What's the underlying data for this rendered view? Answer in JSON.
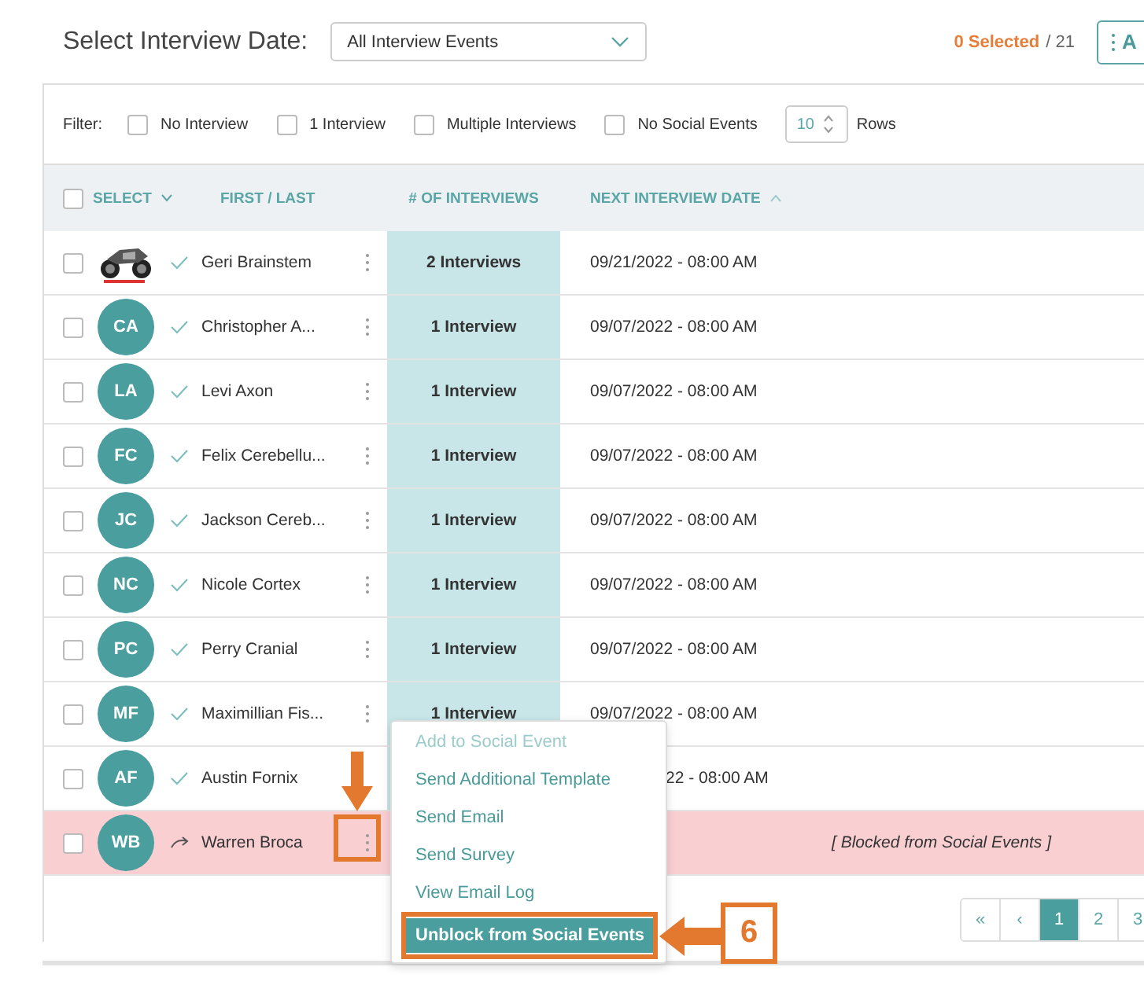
{
  "header": {
    "label": "Select Interview Date:",
    "dropdown": "All Interview Events",
    "selected_count": "0 Selected",
    "total": "/ 21",
    "action_button": "A"
  },
  "filters": {
    "label": "Filter:",
    "options": [
      {
        "label": "No Interview",
        "checked": false
      },
      {
        "label": "1 Interview",
        "checked": false
      },
      {
        "label": "Multiple Interviews",
        "checked": false
      },
      {
        "label": "No Social Events",
        "checked": false
      }
    ],
    "rows_value": "10",
    "rows_label": "Rows"
  },
  "table": {
    "select_all_checked": false,
    "columns": [
      "SELECT",
      "FIRST / LAST",
      "# OF INTERVIEWS",
      "NEXT INTERVIEW DATE"
    ],
    "rows": [
      {
        "kind": "ok",
        "name": "Geri Brainstem",
        "interviews": "2 Interviews",
        "date": "09/21/2022 - 08:00 AM",
        "checked": false
      },
      {
        "avatar": {
          "kind": "initials",
          "text": "CA"
        },
        "kind": "ok",
        "name": "Christopher A...",
        "interviews": "1 Interview",
        "date": "09/07/2022 - 08:00 AM",
        "checked": false
      },
      {
        "avatar": {
          "kind": "initials",
          "text": "LA"
        },
        "kind": "ok",
        "name": "Levi Axon",
        "interviews": "1 Interview",
        "date": "09/07/2022 - 08:00 AM",
        "checked": false
      },
      {
        "avatar": {
          "kind": "initials",
          "text": "FC"
        },
        "kind": "ok",
        "name": "Felix Cerebellu...",
        "interviews": "1 Interview",
        "date": "09/07/2022 - 08:00 AM",
        "checked": false
      },
      {
        "avatar": {
          "kind": "initials",
          "text": "JC"
        },
        "kind": "ok",
        "name": "Jackson Cereb...",
        "interviews": "1 Interview",
        "date": "09/07/2022 - 08:00 AM",
        "checked": false
      },
      {
        "avatar": {
          "kind": "initials",
          "text": "NC"
        },
        "kind": "ok",
        "name": "Nicole Cortex",
        "interviews": "1 Interview",
        "date": "09/07/2022 - 08:00 AM",
        "checked": false
      },
      {
        "avatar": {
          "kind": "initials",
          "text": "PC"
        },
        "kind": "ok",
        "name": "Perry Cranial",
        "interviews": "1 Interview",
        "date": "09/07/2022 - 08:00 AM",
        "checked": false
      },
      {
        "avatar": {
          "kind": "initials",
          "text": "MF"
        },
        "kind": "ok",
        "name": "Maximillian Fis...",
        "interviews": "1 Interview",
        "date": "09/07/2022 - 08:00 AM",
        "checked": false
      },
      {
        "avatar": {
          "kind": "initials",
          "text": "AF"
        },
        "kind": "ok",
        "name": "Austin Fornix",
        "date": "22 - 08:00 AM",
        "covered": true,
        "checked": false
      },
      {
        "avatar": {
          "kind": "initials",
          "text": "WB"
        },
        "kind": "blocked",
        "name": "Warren Broca",
        "note": "[ Blocked from Social Events ]",
        "checked": false
      }
    ]
  },
  "pagination": [
    {
      "label": "«",
      "selected": false
    },
    {
      "label": "‹",
      "selected": false
    },
    {
      "label": "1",
      "selected": true
    },
    {
      "label": "2",
      "selected": false
    },
    {
      "label": "3",
      "selected": false
    }
  ],
  "context_menu": [
    {
      "label": "Add to Social Event",
      "disabled": true,
      "selected": false
    },
    {
      "label": "Send Additional Template",
      "disabled": false,
      "selected": false
    },
    {
      "label": "Send Email",
      "disabled": false,
      "selected": false
    },
    {
      "label": "Send Survey",
      "disabled": false,
      "selected": false
    },
    {
      "label": "View Email Log",
      "disabled": false,
      "selected": false
    },
    {
      "label": "Unblock from Social Events",
      "disabled": false,
      "selected": true
    }
  ],
  "annotation": {
    "step": "6"
  }
}
